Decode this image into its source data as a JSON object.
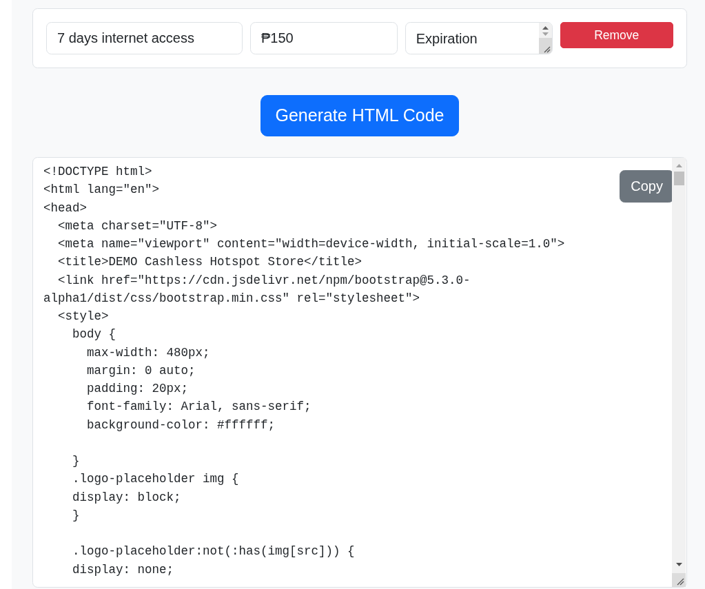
{
  "item_row": {
    "fields": [
      {
        "kind": "text",
        "value": "7 days internet access"
      },
      {
        "kind": "text",
        "value": "₱150"
      },
      {
        "kind": "textarea",
        "value": "Expiration"
      }
    ],
    "remove_button": "Remove"
  },
  "generate_button": "Generate HTML Code",
  "code_output": {
    "text": "<!DOCTYPE html>\n<html lang=\"en\">\n<head>\n  <meta charset=\"UTF-8\">\n  <meta name=\"viewport\" content=\"width=device-width, initial-scale=1.0\">\n  <title>DEMO Cashless Hotspot Store</title>\n  <link href=\"https://cdn.jsdelivr.net/npm/bootstrap@5.3.0-alpha1/dist/css/bootstrap.min.css\" rel=\"stylesheet\">\n  <style>\n    body {\n      max-width: 480px;\n      margin: 0 auto;\n      padding: 20px;\n      font-family: Arial, sans-serif;\n      background-color: #ffffff;\n\n    }\n    .logo-placeholder img {\n    display: block;\n    }\n\n    .logo-placeholder:not(:has(img[src])) {\n    display: none;",
    "copy_button": "Copy"
  }
}
